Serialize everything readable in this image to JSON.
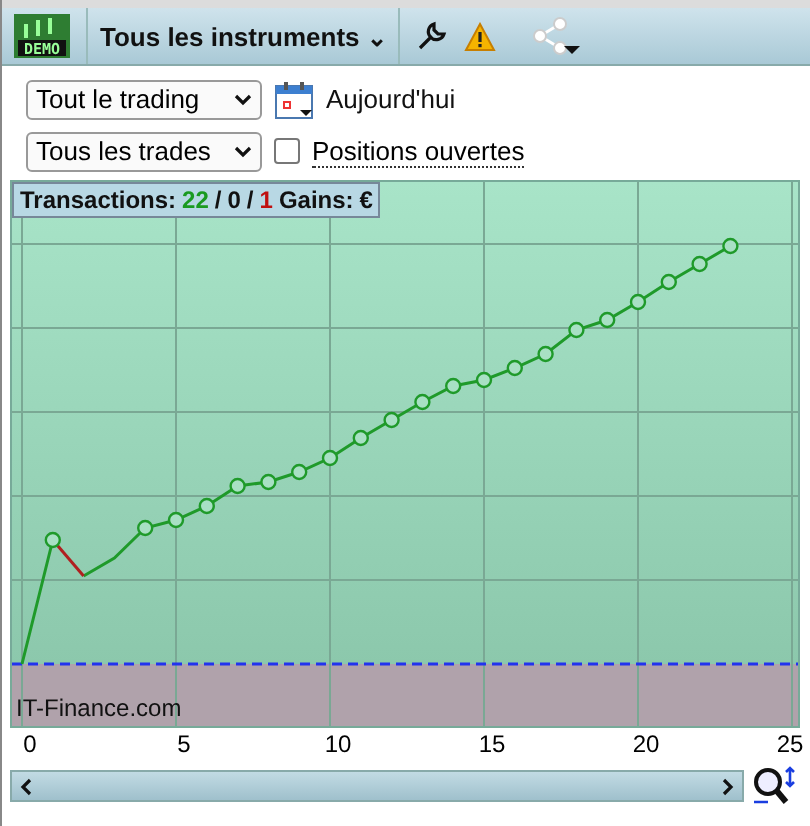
{
  "toolbar": {
    "logo_text": "DEMO",
    "instrument_menu": "Tous les instruments",
    "caret": "⌄"
  },
  "filters": {
    "period": "Tout le trading",
    "date": "Aujourd'hui",
    "trades": "Tous les trades",
    "open_positions": {
      "label": "Positions ouvertes",
      "checked": false
    }
  },
  "stats": [
    {
      "text": "Transactions:",
      "kind": "label"
    },
    {
      "text": "22",
      "kind": "win"
    },
    {
      "text": "/",
      "kind": "sep"
    },
    {
      "text": "0",
      "kind": "neutral"
    },
    {
      "text": "/",
      "kind": "sep"
    },
    {
      "text": "1",
      "kind": "loss"
    },
    {
      "text": "Gains:",
      "kind": "label"
    },
    {
      "text": "€",
      "kind": "neutral"
    }
  ],
  "chart": {
    "watermark": "IT-Finance.com",
    "x_labels": [
      "0",
      "5",
      "10",
      "15",
      "20",
      "25"
    ]
  }
}
